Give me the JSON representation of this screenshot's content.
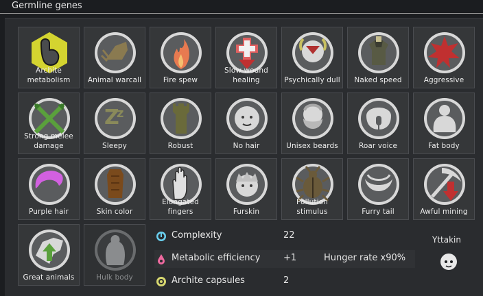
{
  "header": {
    "title": "Germline genes"
  },
  "genes": [
    {
      "label": "Archite metabolism",
      "icon": "archite-stomach-icon"
    },
    {
      "label": "Animal warcall",
      "icon": "animal-warcall-icon"
    },
    {
      "label": "Fire spew",
      "icon": "fire-spew-icon"
    },
    {
      "label": "Slow wound healing",
      "icon": "slow-healing-icon"
    },
    {
      "label": "Psychically dull",
      "icon": "psychic-dull-icon"
    },
    {
      "label": "Naked speed",
      "icon": "naked-speed-icon"
    },
    {
      "label": "Aggressive",
      "icon": "aggressive-icon"
    },
    {
      "label": "Strong melee damage",
      "icon": "crossed-swords-icon"
    },
    {
      "label": "Sleepy",
      "icon": "sleepy-icon"
    },
    {
      "label": "Robust",
      "icon": "robust-tower-icon"
    },
    {
      "label": "No hair",
      "icon": "no-hair-icon"
    },
    {
      "label": "Unisex beards",
      "icon": "beard-icon"
    },
    {
      "label": "Roar voice",
      "icon": "roar-voice-icon"
    },
    {
      "label": "Fat body",
      "icon": "fat-body-icon"
    },
    {
      "label": "Purple hair",
      "icon": "purple-hair-icon"
    },
    {
      "label": "Skin color",
      "icon": "skin-color-icon"
    },
    {
      "label": "Elongated fingers",
      "icon": "hand-icon"
    },
    {
      "label": "Furskin",
      "icon": "furskin-icon"
    },
    {
      "label": "Pollution stimulus",
      "icon": "beetle-icon"
    },
    {
      "label": "Furry tail",
      "icon": "furry-tail-icon"
    },
    {
      "label": "Awful mining",
      "icon": "pickaxe-down-icon"
    },
    {
      "label": "Great animals",
      "icon": "great-animals-icon"
    },
    {
      "label": "Hulk body",
      "icon": "hulk-body-icon"
    }
  ],
  "stats": [
    {
      "label": "Complexity",
      "value": "22",
      "extra": "",
      "icon": "complexity-icon"
    },
    {
      "label": "Metabolic efficiency",
      "value": "+1",
      "extra": "Hunger rate x90%",
      "icon": "metabolism-icon"
    },
    {
      "label": "Archite capsules",
      "value": "2",
      "extra": "",
      "icon": "archite-capsule-icon"
    }
  ],
  "xenotype": {
    "name": "Yttakin",
    "icon": "xenotype-icon"
  },
  "colors": {
    "tile_bg": "#353739",
    "archite_yellow": "#d4d430",
    "melee_green": "#5aa03c",
    "purple": "#d260e0",
    "skin_brown": "#7a4a1c",
    "red_arrow": "#c03030",
    "complexity_blue": "#6ad0f0",
    "metabolism_pink": "#f06aa0",
    "capsule_yellow": "#d8d870"
  }
}
